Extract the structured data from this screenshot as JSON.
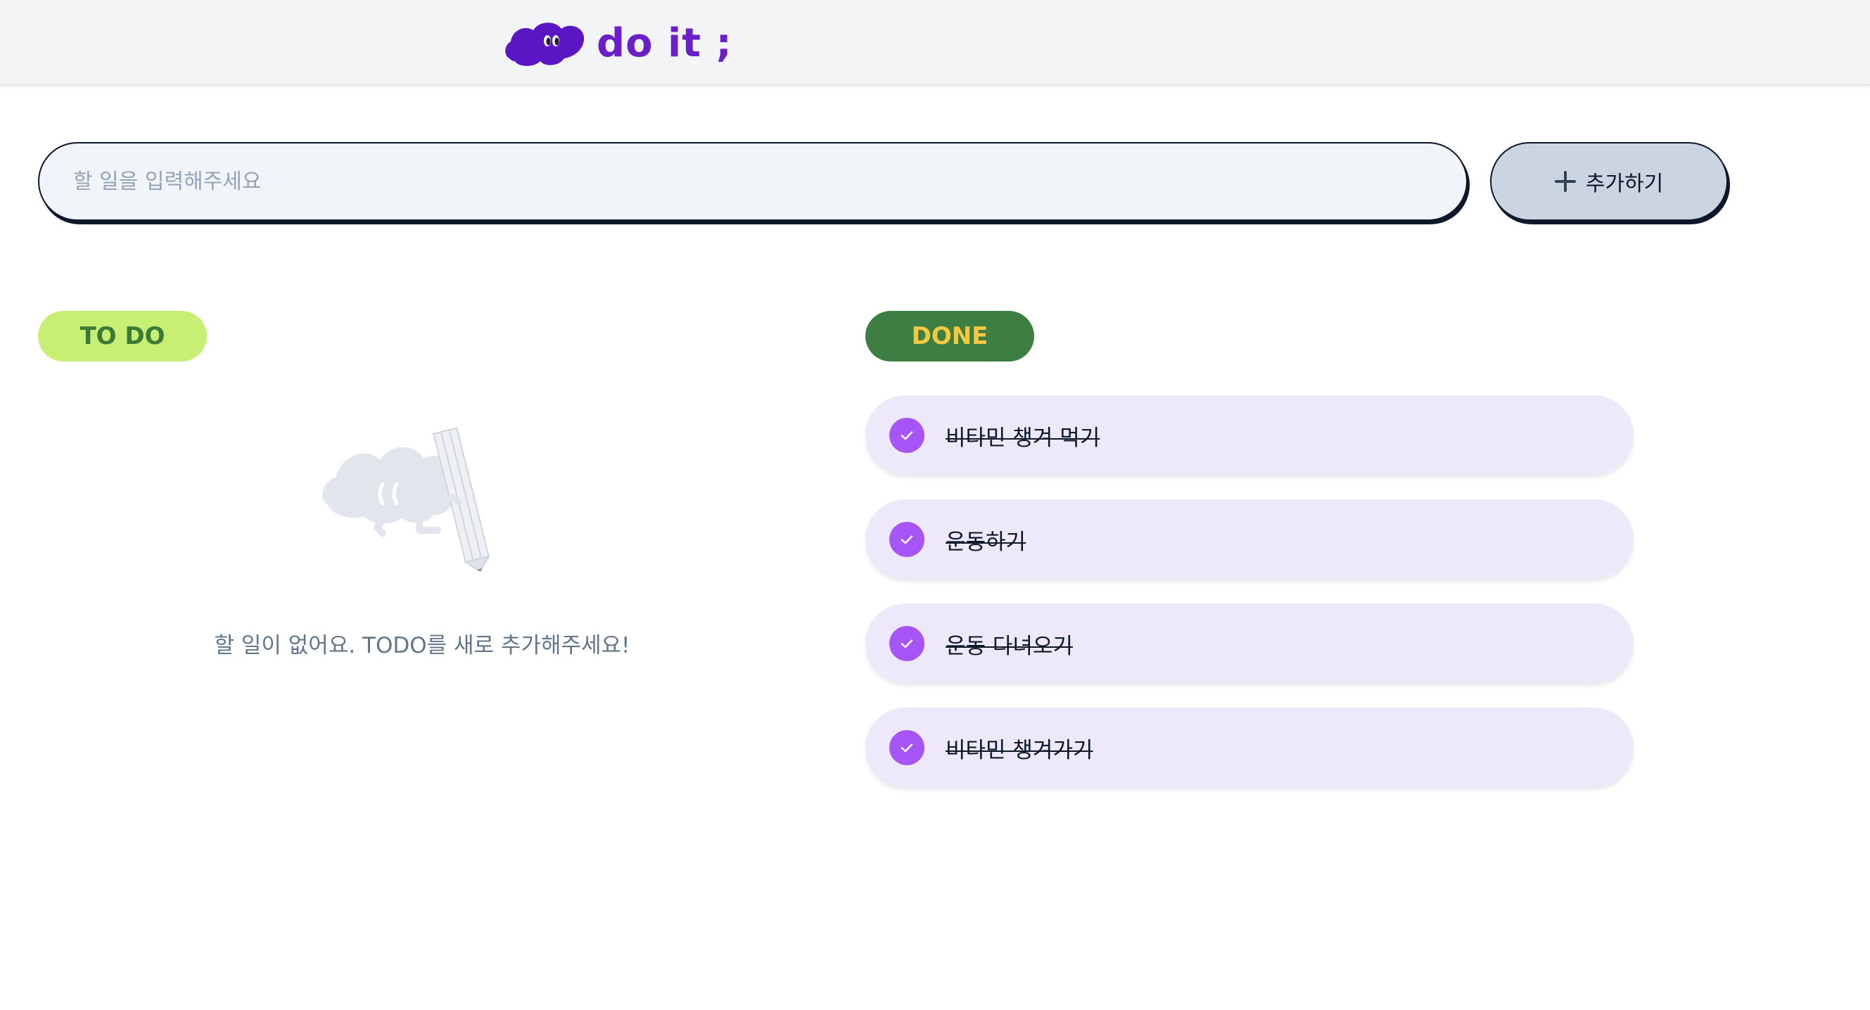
{
  "header": {
    "logo_text": "do it ;",
    "brand_color": "#6b1fc9"
  },
  "search": {
    "placeholder": "할 일을 입력해주세요",
    "value": ""
  },
  "add_button": {
    "label": "추가하기",
    "icon": "plus-icon"
  },
  "todo": {
    "badge_label": "TO DO",
    "empty_message": "할 일이 없어요. TODO를 새로 추가해주세요!",
    "empty_illustration": "empty-cloud-pencil-icon",
    "items": []
  },
  "done": {
    "badge_label": "DONE",
    "items": [
      {
        "label": "비타민 챙겨 먹기",
        "completed": true
      },
      {
        "label": "운동하기",
        "completed": true
      },
      {
        "label": "운동 다녀오기",
        "completed": true
      },
      {
        "label": "비타민 챙겨가기",
        "completed": true
      }
    ]
  },
  "colors": {
    "todo_badge_bg": "#c6ef73",
    "todo_badge_text": "#3b7a36",
    "done_badge_bg": "#3d7f43",
    "done_badge_text": "#f5c842",
    "done_item_bg": "#ede9fb",
    "check_color": "#a855f7"
  }
}
